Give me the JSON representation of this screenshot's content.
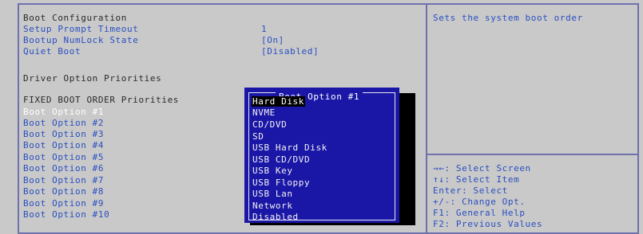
{
  "left": {
    "boot_config_title": "Boot Configuration",
    "setup_prompt_timeout": {
      "label": "Setup Prompt Timeout",
      "value": "1"
    },
    "bootup_numlock_state": {
      "label": "Bootup NumLock State",
      "value": "[On]"
    },
    "quiet_boot": {
      "label": "Quiet Boot",
      "value": "[Disabled]"
    },
    "driver_option_priorities": "Driver Option Priorities",
    "fixed_boot_order_priorities": "FIXED BOOT ORDER Priorities",
    "boot_options": [
      "Boot Option #1",
      "Boot Option #2",
      "Boot Option #3",
      "Boot Option #4",
      "Boot Option #5",
      "Boot Option #6",
      "Boot Option #7",
      "Boot Option #8",
      "Boot Option #9",
      "Boot Option #10"
    ]
  },
  "popup": {
    "title": "Boot Option #1",
    "selected": "Hard Disk",
    "options": [
      "Hard Disk",
      "NVME",
      "CD/DVD",
      "SD",
      "USB Hard Disk",
      "USB CD/DVD",
      "USB Key",
      "USB Floppy",
      "USB Lan",
      "Network",
      "Disabled"
    ]
  },
  "help": {
    "description": "Sets the system boot order",
    "keys": [
      "→←: Select Screen",
      "↑↓: Select Item",
      "Enter: Select",
      "+/-: Change Opt.",
      "F1: General Help",
      "F2: Previous Values"
    ]
  },
  "colors": {
    "background": "#c9c9c9",
    "frame": "#6f71ad",
    "label_blue": "#2a4fc0",
    "popup_bg": "#1a16a6"
  }
}
